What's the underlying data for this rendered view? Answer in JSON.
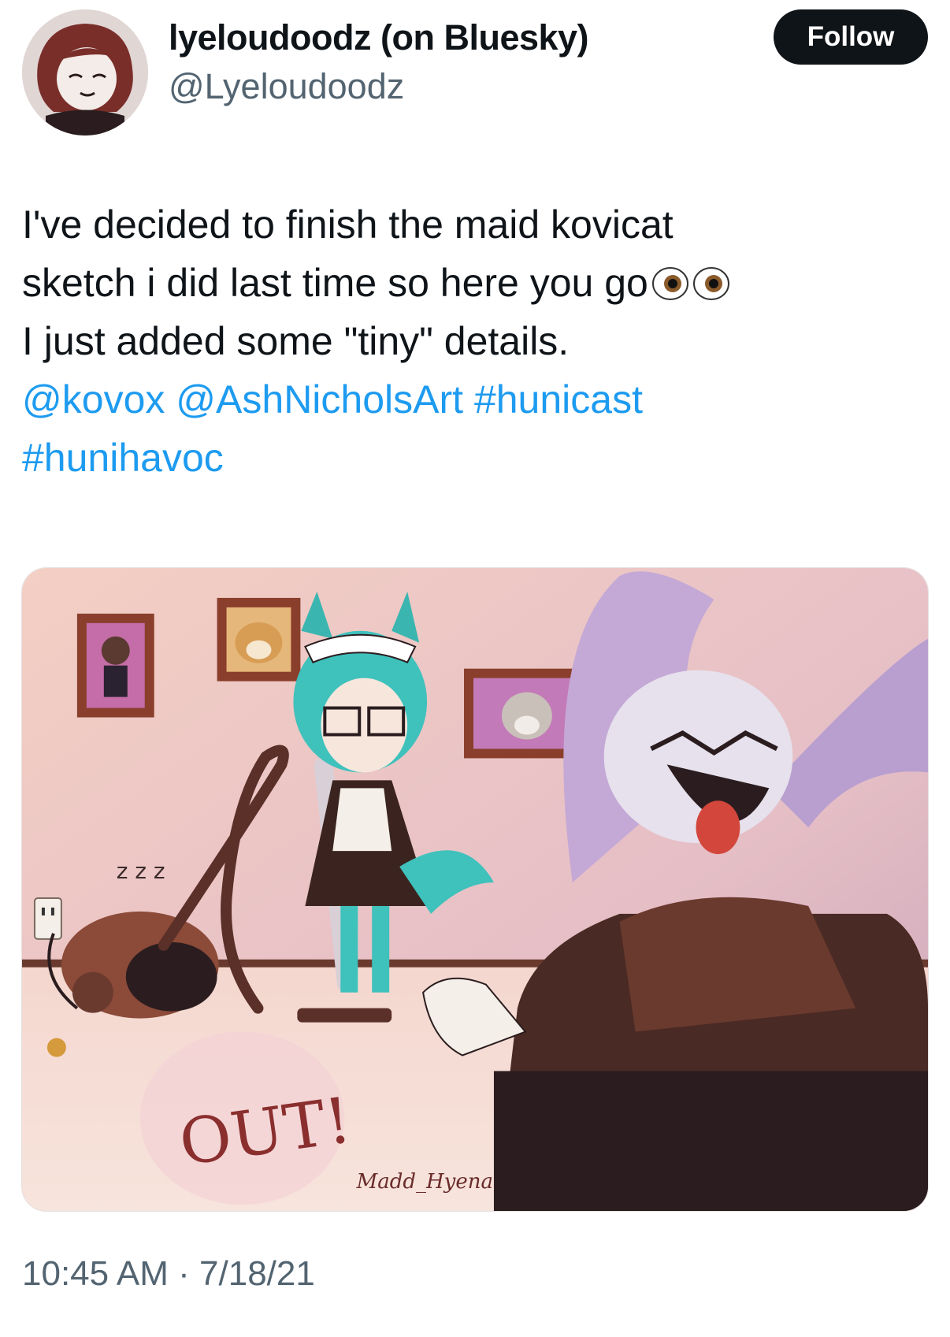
{
  "author": {
    "display_name": "lyeloudoodz (on Bluesky)",
    "handle": "@Lyeloudoodz",
    "avatar": "avatar-icon"
  },
  "follow_button": {
    "label": "Follow"
  },
  "tweet": {
    "line1": "I've decided to finish the maid kovicat",
    "line2": "sketch i did last time so here you go",
    "line3": "I just added some \"tiny\" details.",
    "mention1": "@kovox",
    "mention2": "@AshNicholsArt",
    "hashtag1": "#hunicast",
    "hashtag2": "#hunihavoc",
    "emoji": "eyes-icon"
  },
  "media": {
    "speech_text": "OUT!",
    "signature": "Madd_Hyena",
    "snore": "z z z"
  },
  "meta": {
    "time": "10:45 AM",
    "separator": "·",
    "date": "7/18/21"
  },
  "colors": {
    "text": "#0f1419",
    "secondary": "#536471",
    "link": "#1d9bf0",
    "button": "#0f1419"
  }
}
